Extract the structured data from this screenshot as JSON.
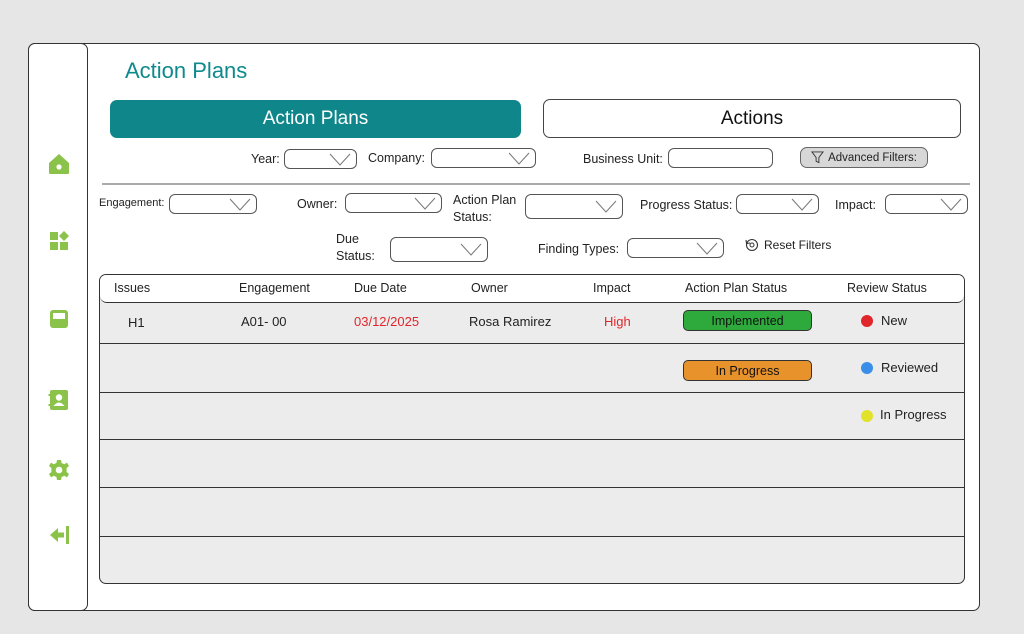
{
  "page_title": "Action Plans",
  "tabs": [
    {
      "label": "Action Plans",
      "active": true
    },
    {
      "label": "Actions",
      "active": false
    }
  ],
  "filters": {
    "year_label": "Year:",
    "company_label": "Company:",
    "business_unit_label": "Business Unit:",
    "advanced_filters_label": "Advanced Filters:",
    "engagement_label": "Engagement:",
    "owner_label": "Owner:",
    "action_plan_status_label_1": "Action Plan",
    "action_plan_status_label_2": "Status:",
    "progress_status_label": "Progress Status:",
    "impact_label": "Impact:",
    "due_status_label_1": "Due",
    "due_status_label_2": "Status:",
    "finding_types_label": "Finding Types:",
    "reset_filters_label": "Reset Filters"
  },
  "table": {
    "columns": [
      "Issues",
      "Engagement",
      "Due Date",
      "Owner",
      "Impact",
      "Action Plan Status",
      "Review Status"
    ],
    "rows": [
      {
        "issue": "H1",
        "engagement": "A01- 00",
        "due_date": "03/12/2025",
        "owner": "Rosa Ramirez",
        "impact": "High",
        "action_plan_status": "Implemented",
        "review_status": "New"
      },
      {
        "issue": "",
        "engagement": "",
        "due_date": "",
        "owner": "",
        "impact": "",
        "action_plan_status": "In Progress",
        "review_status": "Reviewed"
      },
      {
        "issue": "",
        "engagement": "",
        "due_date": "",
        "owner": "",
        "impact": "",
        "action_plan_status": "",
        "review_status": "In Progress"
      }
    ]
  },
  "colors": {
    "brand": "#0e868a",
    "sidebar_icon": "#8bc34a",
    "overdue": "#e0262b",
    "implemented": "#2eaa3c",
    "in_progress": "#e8922c",
    "dot_new": "#e0262b",
    "dot_reviewed": "#3b8ee8",
    "dot_in_progress": "#e2e22a"
  },
  "sidebar": {
    "icons": [
      "home-icon",
      "dashboard-icon",
      "inbox-icon",
      "contacts-icon",
      "settings-icon",
      "logout-icon"
    ]
  }
}
